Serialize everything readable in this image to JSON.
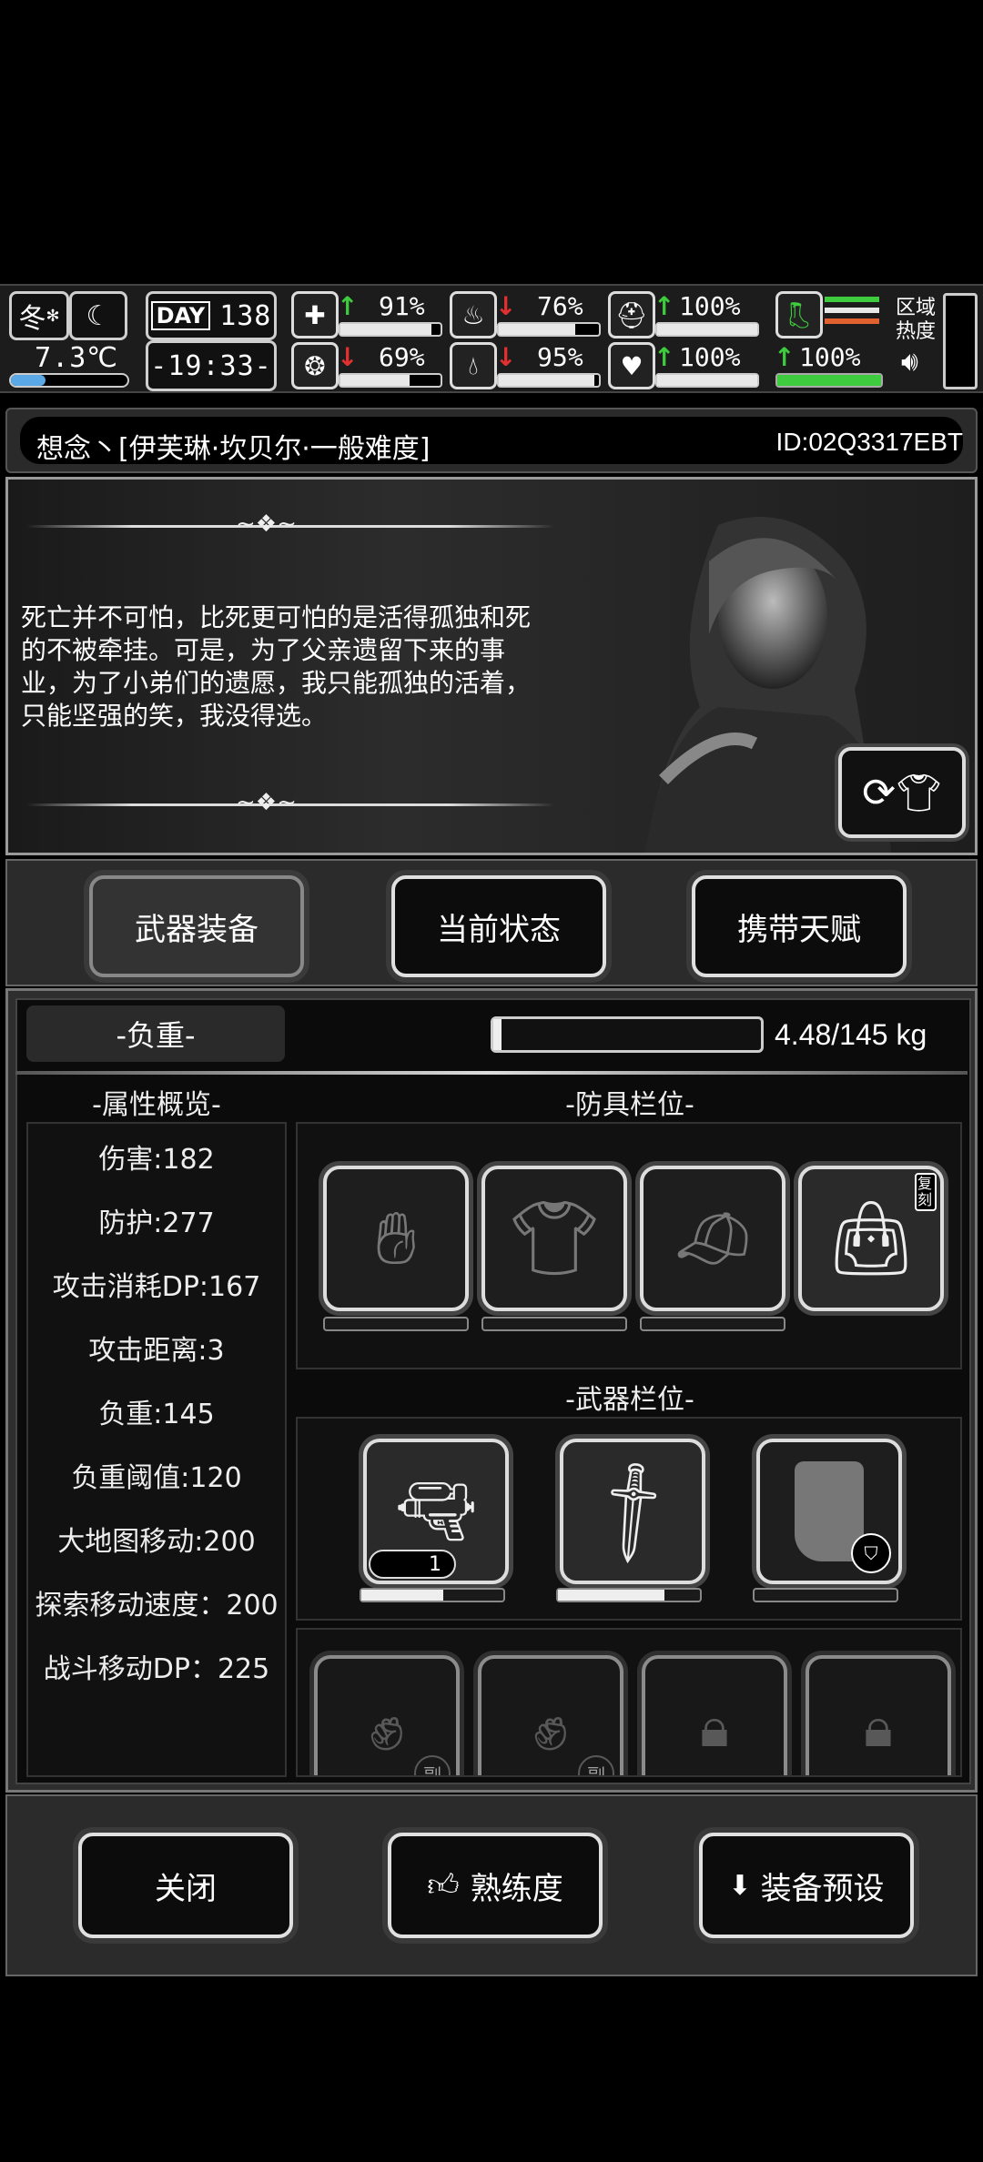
{
  "status": {
    "season": "冬",
    "temperature": "7.3℃",
    "day_label": "DAY",
    "day_number": "138",
    "time": "-19:33-",
    "stats": [
      {
        "name": "health",
        "icon": "medkit-icon",
        "value": "91%",
        "trend": "up",
        "level": 0.91
      },
      {
        "name": "hunger",
        "icon": "stomach-icon",
        "value": "76%",
        "trend": "down",
        "level": 0.76
      },
      {
        "name": "armor",
        "icon": "helmet-icon",
        "value": "100%",
        "trend": "up",
        "level": 1.0
      },
      {
        "name": "mood",
        "icon": "brain-icon",
        "value": "69%",
        "trend": "down",
        "level": 0.69
      },
      {
        "name": "thirst",
        "icon": "water-drop-icon",
        "value": "95%",
        "trend": "down",
        "level": 0.95
      },
      {
        "name": "heart",
        "icon": "heart-icon",
        "value": "100%",
        "trend": "up",
        "level": 1.0
      },
      {
        "name": "stamina",
        "icon": "boot-icon",
        "value": "100%",
        "trend": "up",
        "level": 1.0
      }
    ],
    "zone_heat_label": "区域\n热度"
  },
  "title": {
    "name": "想念丶[伊芙琳·坎贝尔·一般难度]",
    "id": "ID:02Q3317EBT"
  },
  "story": {
    "text": "死亡并不可怕，比死更可怕的是活得孤独和死的不被牵挂。可是，为了父亲遗留下来的事业，为了小弟们的遗愿，我只能孤独的活着，只能坚强的笑，我没得选。"
  },
  "tabs": [
    {
      "label": "武器装备",
      "active": true
    },
    {
      "label": "当前状态",
      "active": false
    },
    {
      "label": "携带天赋",
      "active": false
    }
  ],
  "load": {
    "label": "-负重-",
    "value": "4.48/145 kg",
    "fraction": 0.031
  },
  "attributes": {
    "title": "-属性概览-",
    "items": [
      "伤害:182",
      "防护:277",
      "攻击消耗DP:167",
      "攻击距离:3",
      "负重:145",
      "负重阈值:120",
      "大地图移动:200",
      "探索移动速度：200",
      "战斗移动DP：225"
    ]
  },
  "armor": {
    "title": "-防具栏位-",
    "slots": [
      {
        "name": "gloves",
        "icon": "gloves-icon"
      },
      {
        "name": "shirt",
        "icon": "shirt-icon"
      },
      {
        "name": "visor",
        "icon": "visor-cap-icon"
      },
      {
        "name": "bag",
        "icon": "duffel-bag-icon",
        "badge": "复刻"
      }
    ]
  },
  "weapons": {
    "title": "-武器栏位-",
    "slots": [
      {
        "name": "revolver",
        "icon": "revolver-icon",
        "ammo": "1",
        "durability": 0.58
      },
      {
        "name": "machete",
        "icon": "machete-icon",
        "durability": 0.75
      },
      {
        "name": "riot-shield",
        "icon": "riot-shield-icon",
        "durability": 0.0
      }
    ]
  },
  "sub_slots": [
    {
      "badge": "副",
      "locked": false
    },
    {
      "badge": "副",
      "locked": false
    },
    {
      "badge": "",
      "locked": true
    },
    {
      "badge": "",
      "locked": true
    }
  ],
  "bottom": {
    "close": "关闭",
    "proficiency": "熟练度",
    "preset": "装备预设"
  }
}
